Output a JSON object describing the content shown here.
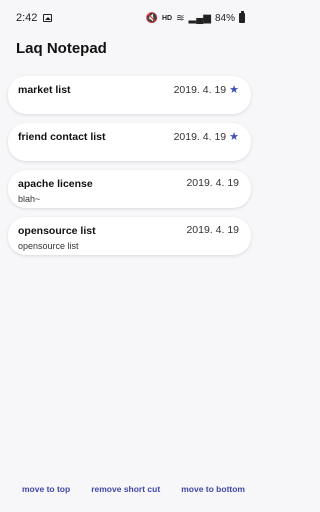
{
  "status_bar": {
    "time": "2:42",
    "network": "HD",
    "battery": "84%"
  },
  "app": {
    "title": "Laq Notepad"
  },
  "notes": [
    {
      "title": "market list",
      "subtitle": "",
      "date": "2019. 4. 19",
      "starred": true
    },
    {
      "title": "friend contact list",
      "subtitle": "",
      "date": "2019. 4. 19",
      "starred": true
    },
    {
      "title": "apache license",
      "subtitle": "blah~",
      "date": "2019. 4. 19",
      "starred": false
    },
    {
      "title": "opensource list",
      "subtitle": "opensource list",
      "date": "2019. 4. 19",
      "starred": false
    }
  ],
  "actions": {
    "move_to_top": "move to top",
    "remove_short_cut": "remove short cut",
    "move_to_bottom": "move to bottom"
  },
  "colors": {
    "accent": "#3f47a8",
    "star": "#3f51b5",
    "background": "#f7f7f9"
  }
}
